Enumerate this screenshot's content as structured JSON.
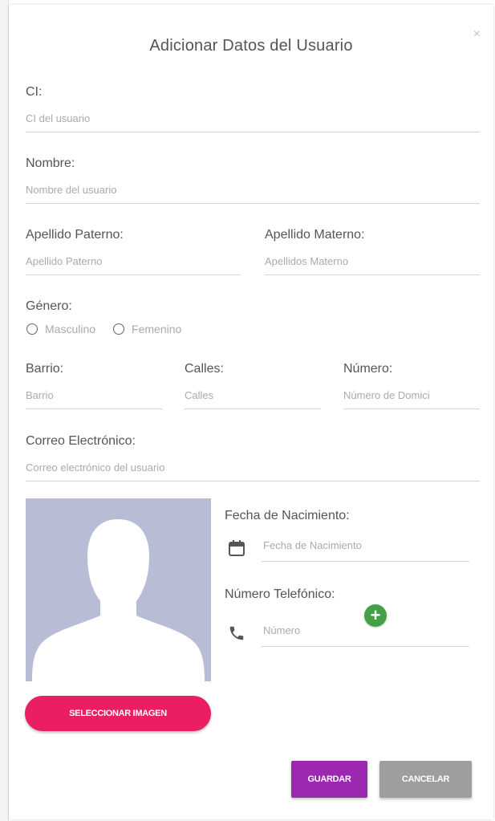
{
  "modal": {
    "title": "Adicionar Datos del Usuario",
    "close_label": "×"
  },
  "fields": {
    "ci": {
      "label": "CI:",
      "placeholder": "CI del usuario"
    },
    "nombre": {
      "label": "Nombre:",
      "placeholder": "Nombre del usuario"
    },
    "apellido_paterno": {
      "label": "Apellido Paterno:",
      "placeholder": "Apellido Paterno"
    },
    "apellido_materno": {
      "label": "Apellido Materno:",
      "placeholder": "Apellidos Materno"
    },
    "barrio": {
      "label": "Barrio:",
      "placeholder": "Barrio"
    },
    "calles": {
      "label": "Calles:",
      "placeholder": "Calles"
    },
    "numero": {
      "label": "Número:",
      "placeholder": "Número de Domici"
    },
    "correo": {
      "label": "Correo Electrónico:",
      "placeholder": "Correo electrónico del usuario"
    },
    "fecha": {
      "label": "Fecha de Nacimiento:",
      "placeholder": "Fecha de Nacimiento"
    },
    "telefono": {
      "label": "Número Telefónico:",
      "placeholder": "Número"
    }
  },
  "genero": {
    "label": "Género:",
    "options": [
      "Masculino",
      "Femenino"
    ]
  },
  "photo": {
    "button_label": "SELECCIONAR IMAGEN"
  },
  "actions": {
    "add_phone_label": "+",
    "save_label": "GUARDAR",
    "cancel_label": "CANCELAR"
  },
  "colors": {
    "accent_pink": "#e91e63",
    "save_purple": "#9c27b0",
    "cancel_gray": "#9e9e9e",
    "add_green": "#43a047",
    "avatar_bg": "#b8bdd5"
  },
  "icons": {
    "close": "close-icon",
    "calendar": "calendar-icon",
    "phone": "phone-icon",
    "avatar": "avatar-silhouette",
    "radio": "radio-unchecked-icon"
  }
}
